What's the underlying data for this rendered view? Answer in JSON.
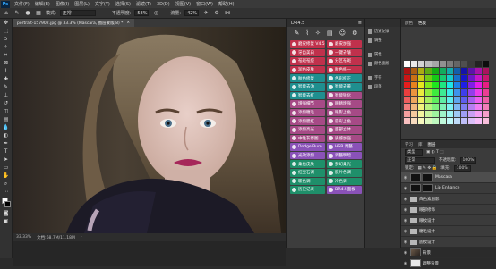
{
  "app": {
    "logo": "Ps"
  },
  "menu": [
    "文件(F)",
    "编辑(E)",
    "图像(I)",
    "图层(L)",
    "文字(Y)",
    "选择(S)",
    "滤镜(T)",
    "3D(D)",
    "视图(V)",
    "窗口(W)",
    "帮助(H)"
  ],
  "options_bar": {
    "mode_label": "模式:",
    "mode_value": "正常",
    "opacity_label": "不透明度:",
    "opacity_value": "58%",
    "flow_label": "流量:",
    "flow_value": "42%"
  },
  "document": {
    "tab_title": "portrait-157902.jpg @ 33.3% (Mascara, 图层蒙版/8) *",
    "zoom": "33.33%",
    "doc_info": "文档:68.7M/11.18M"
  },
  "plugin": {
    "title": "DR4.5",
    "buttons": [
      {
        "label": "磨皮修复 V4.5",
        "color": "#c0314c"
      },
      {
        "label": "磨皮加强",
        "color": "#c0314c"
      },
      {
        "label": "牙齿美白",
        "color": "#c0314c"
      },
      {
        "label": "一键去皱",
        "color": "#c0314c"
      },
      {
        "label": "祛斑祛痘",
        "color": "#c0314c"
      },
      {
        "label": "分区祛斑",
        "color": "#c0314c"
      },
      {
        "label": "润色皮肤",
        "color": "#c0314c"
      },
      {
        "label": "肤色统一",
        "color": "#c0314c"
      },
      {
        "label": "肤色修复",
        "color": "#1f8f8f"
      },
      {
        "label": "色彩校正",
        "color": "#1f8f8f"
      },
      {
        "label": "智能去油",
        "color": "#1f8f8f"
      },
      {
        "label": "智能去黄",
        "color": "#1f8f8f"
      },
      {
        "label": "智能去红",
        "color": "#1f8f8f"
      },
      {
        "label": "智能锐化",
        "color": "#a64a86"
      },
      {
        "label": "增强细节",
        "color": "#a64a86"
      },
      {
        "label": "眼睛增强",
        "color": "#a64a86"
      },
      {
        "label": "添加睫毛",
        "color": "#a64a86"
      },
      {
        "label": "眼影上色",
        "color": "#a64a86"
      },
      {
        "label": "添加腮红",
        "color": "#a64a86"
      },
      {
        "label": "唇彩上色",
        "color": "#a64a86"
      },
      {
        "label": "添加高光",
        "color": "#a64a86"
      },
      {
        "label": "面部立体",
        "color": "#a64a86"
      },
      {
        "label": "中性灰修图",
        "color": "#a64a86"
      },
      {
        "label": "质感加强",
        "color": "#a64a86"
      },
      {
        "label": "Dodge Burn",
        "color": "#8a52b8"
      },
      {
        "label": "HSB 调整",
        "color": "#8a52b8"
      },
      {
        "label": "光效添加",
        "color": "#8a52b8"
      },
      {
        "label": "调整明暗",
        "color": "#8a52b8"
      },
      {
        "label": "柔化皮肤",
        "color": "#1f8f6a"
      },
      {
        "label": "梦幻柔光",
        "color": "#1f8f6a"
      },
      {
        "label": "红宝石调",
        "color": "#1f8f6a"
      },
      {
        "label": "胶片色调",
        "color": "#1f8f6a"
      },
      {
        "label": "暖色调",
        "color": "#1f8f6a"
      },
      {
        "label": "冷色调",
        "color": "#1f8f6a"
      },
      {
        "label": "历史记录",
        "color": "#1f8f6a"
      },
      {
        "label": "DR4.5面板",
        "color": "#8a52b8"
      }
    ]
  },
  "right_column": [
    {
      "label": "历史记录",
      "icon": "history-icon"
    },
    {
      "label": "调整",
      "icon": "adjust-icon"
    },
    {
      "label": "属性",
      "icon": "properties-icon"
    },
    {
      "label": "颜色面板",
      "icon": "color-icon"
    },
    {
      "label": "字符",
      "icon": "character-icon"
    },
    {
      "label": "段落",
      "icon": "paragraph-icon"
    }
  ],
  "swatches_panel": {
    "tabs": [
      "颜色",
      "色板"
    ],
    "active": 1
  },
  "layers_panel": {
    "tabs": [
      "学习",
      "库",
      "图层"
    ],
    "kind_label": "类型",
    "blend_mode": "正常",
    "opacity_label": "不透明度:",
    "opacity_value": "100%",
    "fill_label": "填充:",
    "fill_value": "100%",
    "lock_label": "锁定:",
    "layers": [
      {
        "name": "Mascara",
        "type": "mask",
        "selected": true
      },
      {
        "name": "Lip Enhance",
        "type": "mask",
        "selected": false
      },
      {
        "name": "白色素眉影",
        "type": "folder",
        "selected": false
      },
      {
        "name": "眼部修饰",
        "type": "folder",
        "selected": false
      },
      {
        "name": "眼妆设计",
        "type": "folder",
        "selected": false
      },
      {
        "name": "睫毛设计",
        "type": "folder",
        "selected": false
      },
      {
        "name": "底妆设计",
        "type": "folder",
        "selected": false
      },
      {
        "name": "背景",
        "type": "photo",
        "selected": false
      },
      {
        "name": "调整背景",
        "type": "white",
        "selected": false
      }
    ]
  },
  "colors": {
    "ui_dark": "#2b2b2b",
    "panel": "#3b3b3b",
    "accent_red": "#c0314c",
    "accent_teal": "#1f8f8f",
    "accent_purple": "#8a52b8",
    "accent_magenta": "#a64a86",
    "accent_green": "#1f8f6a"
  }
}
